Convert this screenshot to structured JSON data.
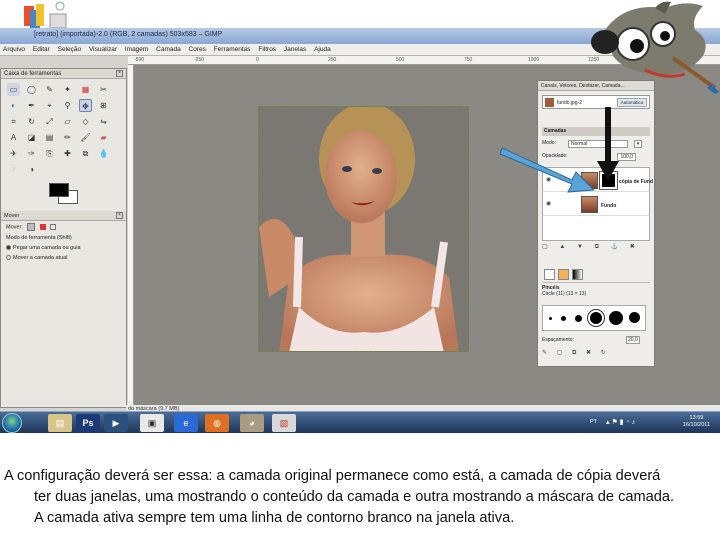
{
  "window": {
    "title": "[retrato] (importada)-2.0 (RGB, 2 camadas) 503x583 – GIMP"
  },
  "menu": [
    "Arquivo",
    "Editar",
    "Seleção",
    "Visualizar",
    "Imagem",
    "Camada",
    "Cores",
    "Ferramentas",
    "Filtros",
    "Janelas",
    "Ajuda"
  ],
  "ruler_ticks": [
    "-500",
    "-250",
    "0",
    "250",
    "500",
    "750",
    "1000",
    "1250"
  ],
  "toolbox": {
    "title": "Caixa de ferramentas",
    "options_title": "Mover",
    "move_label": "Mover:",
    "tool_mode_label": "Modo de ferramenta (Shift)",
    "option1": "Pegar uma camada ou guia",
    "option2": "Mover a camada atual"
  },
  "layers_dialog": {
    "title": "Canais, Vetores, Desfazer, Camada...",
    "image_name": "fundo.jpg-2",
    "auto_button": "Automático",
    "section": "Camadas",
    "mode_label": "Modo:",
    "mode_value": "Normal",
    "opacity_label": "Opacidade:",
    "opacity_value": "100,0",
    "layers": [
      {
        "name": "cópia de Fund"
      },
      {
        "name": "Fundo"
      }
    ],
    "brush_section": "Pincéis",
    "brush_name": "Circle (11) (13 × 13)",
    "spacing_label": "Espaçamento:",
    "spacing_value": "20,0"
  },
  "status": "do máscara (9,7 MB)",
  "tray": {
    "lang": "PT",
    "time": "13:59",
    "date": "16/10/2011"
  },
  "caption": {
    "line1": "A configuração deverá ser  essa: a camada original permanece como está, a camada de cópia deverá",
    "line2": "ter duas janelas, uma mostrando o conteúdo da camada e outra mostrando a máscara de camada.",
    "line3": "A camada ativa sempre tem uma linha de contorno branco na janela ativa."
  }
}
